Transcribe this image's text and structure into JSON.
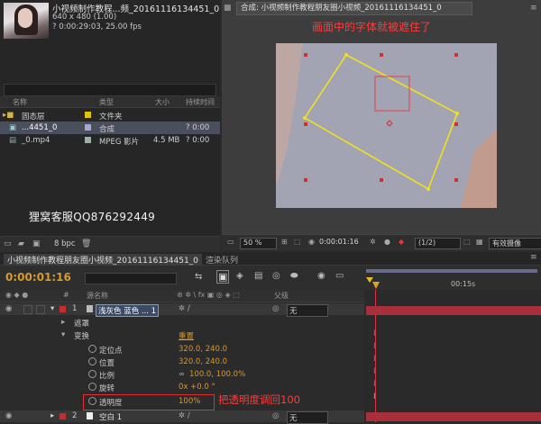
{
  "project": {
    "title": "小视频制作教程...频_20161116134451_0",
    "info_size": "640 x 480 (1.00)",
    "info_duration": "? 0:00:29:03, 25.00 fps",
    "search_placeholder": "",
    "columns": [
      "名称",
      "类型",
      "大小",
      "持续时间"
    ],
    "items": [
      {
        "name": "固态层",
        "type": "文件夹",
        "size": "",
        "duration": "",
        "color": "#e0c600"
      },
      {
        "name": "...4451_0",
        "type": "合成",
        "size": "",
        "duration": "? 0:00",
        "color": "#a8a8c8"
      },
      {
        "name": "_0.mp4",
        "type": "MPEG 影片",
        "size": "4.5 MB",
        "duration": "? 0:00",
        "color": "#9fb0a8"
      }
    ],
    "bpc": "8 bpc"
  },
  "watermark": "狸窝客服QQ876292449",
  "viewer": {
    "tab": "合成: 小视频制作教程朋友圈小视频_20161116134451_0",
    "annotation": "画面中的字体就被遮住了",
    "zoom": "50 %",
    "timecode": "0:00:01:16",
    "resolution": "(1/2)",
    "camera": "有效摄像"
  },
  "timeline": {
    "tab_comp": "小视频制作教程朋友圈小视频_20161116134451_0",
    "tab_render": "渲染队列",
    "timecode": "0:00:01:16",
    "col_num": "#",
    "col_source": "源名称",
    "col_parent": "父级",
    "ruler_mark": "00:15s",
    "layer1": {
      "num": "1",
      "name": "浅灰色 蓝色 ... 1",
      "parent": "无"
    },
    "mask": "遮罩",
    "transform": "变换",
    "reset": "重置",
    "props": [
      {
        "label": "定位点",
        "value": "320.0, 240.0"
      },
      {
        "label": "位置",
        "value": "320.0, 240.0"
      },
      {
        "label": "比例",
        "value": "100.0, 100.0%"
      },
      {
        "label": "旋转",
        "value": "0x +0.0 °"
      },
      {
        "label": "透明度",
        "value": "100%"
      }
    ],
    "layer2": {
      "num": "2",
      "name": "空白 1",
      "parent": "无"
    },
    "annotation": "把透明度调回100"
  },
  "colors": {
    "accent": "#d69a2e",
    "annotation": "#ff3b3b",
    "layer_bar": "#a8303a"
  }
}
